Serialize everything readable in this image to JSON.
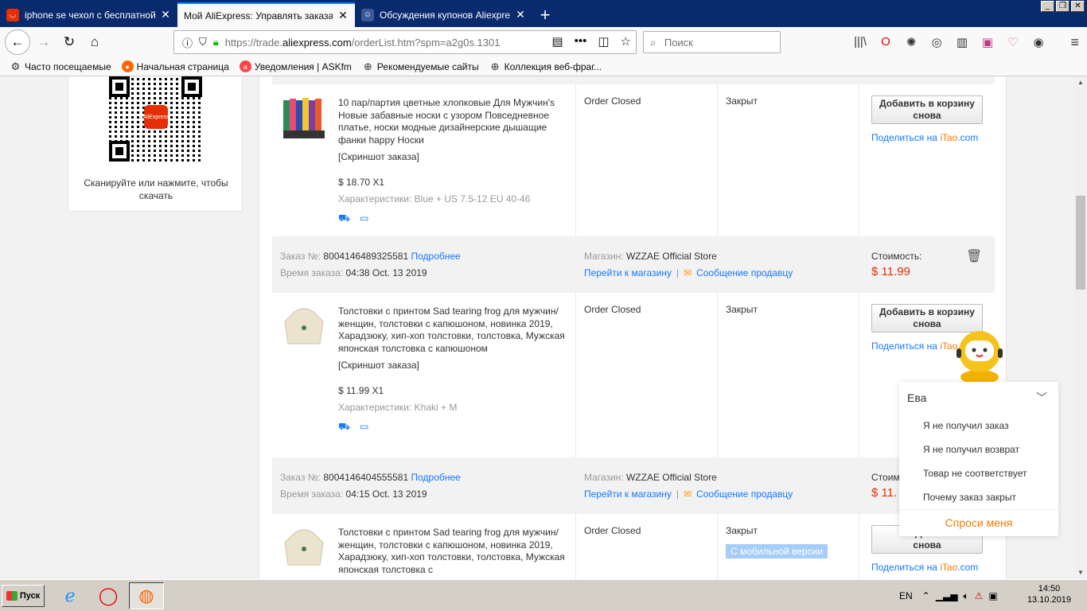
{
  "browser": {
    "tabs": [
      {
        "title": "iphone se чехол с бесплатной до",
        "icon": "aliexpress-icon",
        "color": "#e62e04"
      },
      {
        "title": "Мой AliExpress: Управлять заказами",
        "icon": "none",
        "color": ""
      },
      {
        "title": "Обсуждения купонов Aliexpress",
        "icon": "forum-icon",
        "color": "#3b5998"
      }
    ],
    "url_prefix": "https://trade.",
    "url_domain": "aliexpress.com",
    "url_suffix": "/orderList.htm?spm=a2g0s.1301",
    "search_placeholder": "Поиск",
    "bookmarks": [
      "Часто посещаемые",
      "Начальная страница",
      "Уведомления | ASKfm",
      "Рекомендуемые сайты",
      "Коллекция веб-фраг..."
    ]
  },
  "qr": {
    "logo_text": "AliExpress",
    "caption": "Сканируйте или нажмите, чтобы скачать"
  },
  "labels": {
    "order_no": "Заказ №:",
    "more": "Подробнее",
    "order_time": "Время заказа:",
    "store": "Магазин:",
    "go_store": "Перейти к магазину",
    "msg_seller": "Сообщение продавцу",
    "cost": "Стоимость:",
    "add_cart": "Добавить в корзину снова",
    "share": "Поделиться на",
    "itao_a": "iTao",
    "itao_b": ".com",
    "snapshot": "[Скриншот заказа]",
    "props": "Характеристики:"
  },
  "orders": [
    {
      "product": "10 пар/партия цветные хлопковые Для Мужчин's Новые забавные носки с узором Повседневное платье, носки модные дизайнерские дышащие фанки happy Носки",
      "price": "$ 18.70 X1",
      "props": "Blue + US 7.5-12 EU 40-46",
      "status": "Order Closed",
      "state": "Закрыт"
    },
    {
      "order_no": "8004146489325581",
      "time": "04:38 Oct. 13 2019",
      "store": "WZZAE Official Store",
      "cost": "$ 11.99",
      "product": "Толстовки с принтом Sad tearing frog для мужчин/женщин, толстовки с капюшоном, новинка 2019, Харадзюку, хип-хоп толстовки, толстовка, Мужская японская толстовка с капюшоном",
      "price": "$ 11.99 X1",
      "props": "Khaki + M",
      "status": "Order Closed",
      "state": "Закрыт"
    },
    {
      "order_no": "8004146404555581",
      "time": "04:15 Oct. 13 2019",
      "store": "WZZAE Official Store",
      "cost": "$ 11.",
      "cost_label": "Стоим",
      "product": "Толстовки с принтом Sad tearing frog для мужчин/женщин, толстовки с капюшоном, новинка 2019, Харадзюку, хип-хоп толстовки, толстовка, Мужская японская толстовка с",
      "status": "Order Closed",
      "state": "Закрыт",
      "mobile_badge": "С мобильной версии",
      "btn_partial": "Доба",
      "btn_partial2": "снова"
    }
  ],
  "chat": {
    "agent": "Ева",
    "questions": [
      "Я не получил заказ",
      "Я не получил возврат",
      "Товар не соответствует",
      "Почему заказ закрыт"
    ],
    "ask": "Спроси меня"
  },
  "taskbar": {
    "start": "Пуск",
    "lang": "EN",
    "time": "14:50",
    "date": "13.10.2019"
  },
  "colors": {
    "accent": "#1677ff",
    "price": "#e62e04",
    "itao": "#f77b00"
  }
}
